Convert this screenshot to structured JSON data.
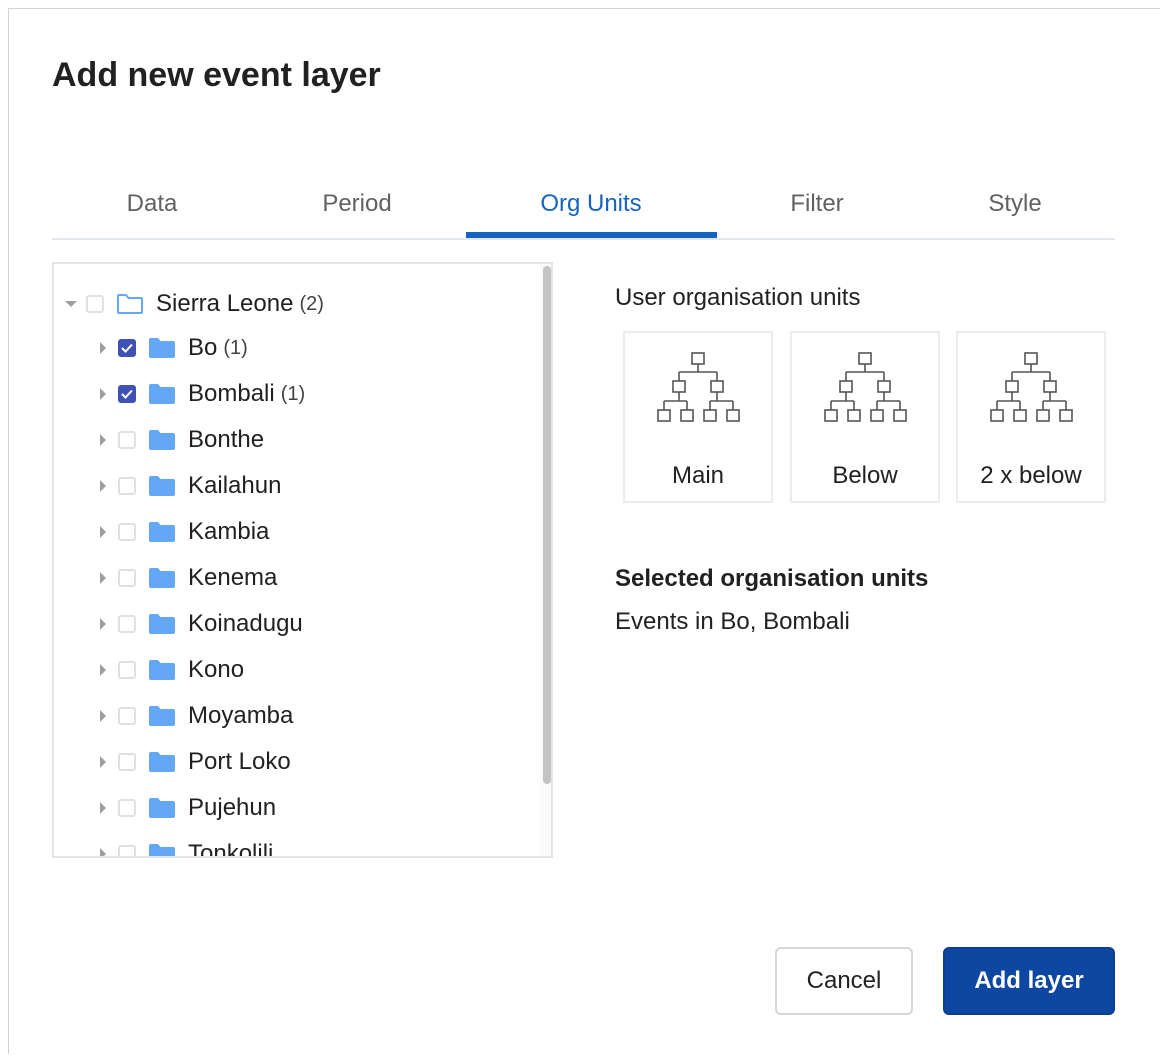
{
  "dialog": {
    "title": "Add new event layer"
  },
  "tabs": [
    {
      "label": "Data"
    },
    {
      "label": "Period"
    },
    {
      "label": "Org Units",
      "active": true
    },
    {
      "label": "Filter"
    },
    {
      "label": "Style"
    }
  ],
  "tree": {
    "root": {
      "label": "Sierra Leone",
      "count": "(2)",
      "expanded": true,
      "checked": false
    },
    "children": [
      {
        "label": "Bo",
        "count": "(1)",
        "checked": true
      },
      {
        "label": "Bombali",
        "count": "(1)",
        "checked": true
      },
      {
        "label": "Bonthe",
        "count": "",
        "checked": false
      },
      {
        "label": "Kailahun",
        "count": "",
        "checked": false
      },
      {
        "label": "Kambia",
        "count": "",
        "checked": false
      },
      {
        "label": "Kenema",
        "count": "",
        "checked": false
      },
      {
        "label": "Koinadugu",
        "count": "",
        "checked": false
      },
      {
        "label": "Kono",
        "count": "",
        "checked": false
      },
      {
        "label": "Moyamba",
        "count": "",
        "checked": false
      },
      {
        "label": "Port Loko",
        "count": "",
        "checked": false
      },
      {
        "label": "Pujehun",
        "count": "",
        "checked": false
      },
      {
        "label": "Tonkolili",
        "count": "",
        "checked": false
      }
    ]
  },
  "user_org_units": {
    "label": "User organisation units",
    "levels": [
      {
        "label": "Main",
        "icon": "org-hierarchy-icon"
      },
      {
        "label": "Below",
        "icon": "org-hierarchy-icon"
      },
      {
        "label": "2 x below",
        "icon": "org-hierarchy-icon"
      }
    ]
  },
  "selected": {
    "heading": "Selected organisation units",
    "text": "Events in Bo, Bombali"
  },
  "actions": {
    "cancel_label": "Cancel",
    "add_label": "Add layer"
  },
  "colors": {
    "accent": "#1565c0",
    "primary_button": "#0d47a1",
    "checkbox_checked": "#3f51b5",
    "folder": "#64a8f5"
  }
}
